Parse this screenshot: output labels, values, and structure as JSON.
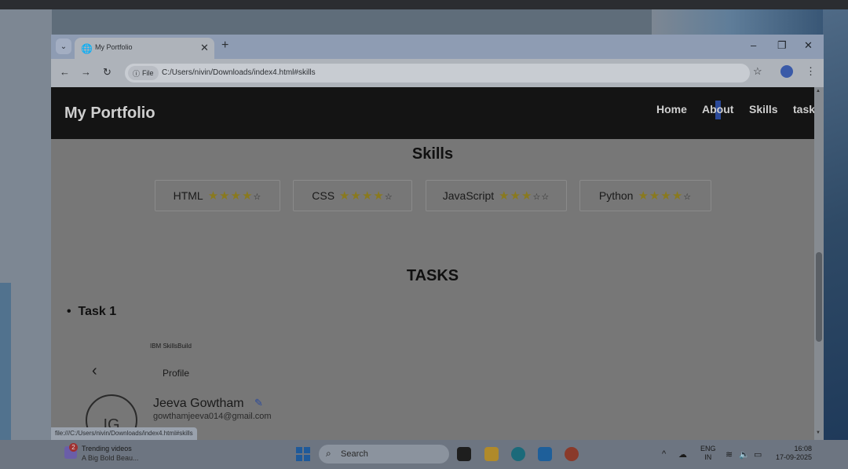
{
  "browser": {
    "tab_title": "My Portfolio",
    "tab_close": "✕",
    "new_tab": "+",
    "tab_search_glyph": "⌄",
    "window_controls": {
      "minimize": "–",
      "restore": "❐",
      "close": "✕"
    },
    "nav": {
      "back": "←",
      "forward": "→",
      "reload": "↻"
    },
    "site_chip": "File",
    "url": "C:/Users/nivin/Downloads/index4.html#skills",
    "status_url": "file:///C:/Users/nivin/Downloads/index4.html#skills"
  },
  "site": {
    "brand": "My Portfolio",
    "nav": [
      "Home",
      "About",
      "Skills",
      "task"
    ],
    "skills_heading": "Skills",
    "skills": [
      {
        "name": "HTML",
        "rating": 4,
        "max": 5
      },
      {
        "name": "CSS",
        "rating": 4,
        "max": 5
      },
      {
        "name": "JavaScript",
        "rating": 3,
        "max": 5
      },
      {
        "name": "Python",
        "rating": 4,
        "max": 5
      }
    ],
    "tasks_heading": "TASKS",
    "task_bullet": "•",
    "task_item": "Task 1",
    "ibm_brand": "IBM SkillsBuild",
    "profile_back": "‹",
    "profile_label": "Profile",
    "avatar_initials": "IG",
    "profile_name": "Jeeva Gowtham",
    "profile_email": "gowthamjeeva014@gmail.com"
  },
  "taskbar": {
    "news_badge": "2",
    "news_title": "Trending videos",
    "news_subtitle": "A Big Bold Beau...",
    "search_label": "Search",
    "tray_chevron": "^",
    "lang_top": "ENG",
    "lang_bottom": "IN",
    "time": "16:08",
    "date": "17-09-2025"
  },
  "colors": {
    "header_bg": "#141414",
    "star_gold": "#8a7a1e",
    "accent_blue": "#2b4a9a"
  }
}
